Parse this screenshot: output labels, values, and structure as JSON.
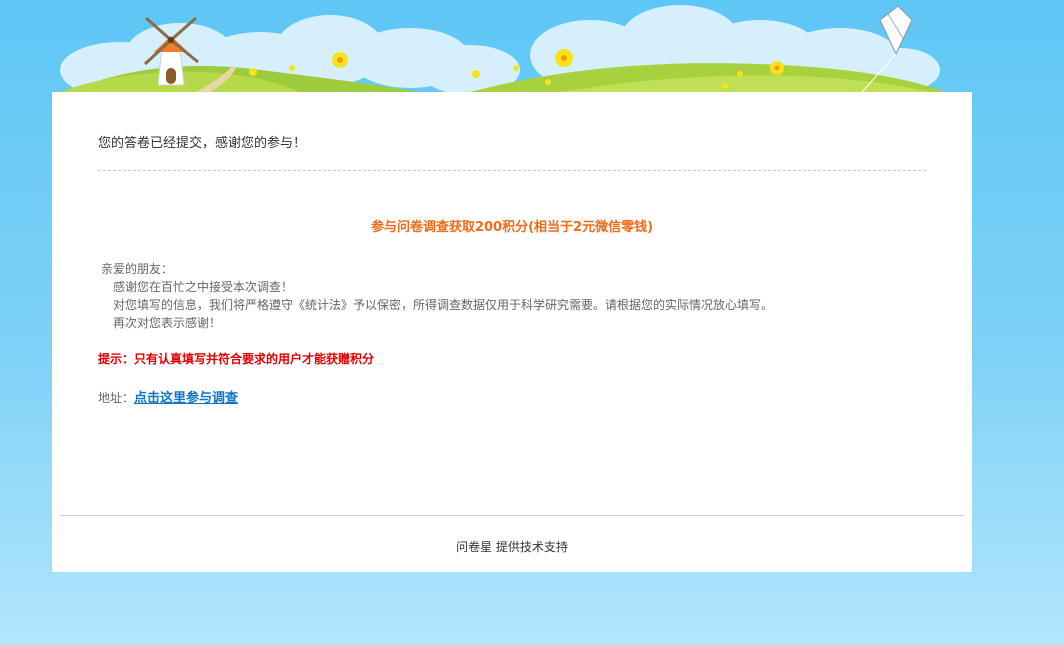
{
  "header": {
    "icons": [
      "windmill-icon",
      "kite-icon",
      "flower-icon",
      "cloud-icon"
    ]
  },
  "main": {
    "submitted_message": "您的答卷已经提交，感谢您的参与！",
    "promo_title": "参与问卷调查获取200积分(相当于2元微信零钱)",
    "letter": {
      "greeting": "亲爱的朋友：",
      "line1": "感谢您在百忙之中接受本次调查！",
      "line2": "对您填写的信息，我们将严格遵守《统计法》予以保密，所得调查数据仅用于科学研究需要。请根据您的实际情况放心填写。",
      "line3": "再次对您表示感谢！"
    },
    "tip": "提示：只有认真填写并符合要求的用户才能获赠积分",
    "address_label": "地址：",
    "address_link": "点击这里参与调查"
  },
  "footer": {
    "text": "问卷星 提供技术支持"
  },
  "colors": {
    "promo": "#f06b1a",
    "tip": "#e60000",
    "link": "#0d74c7",
    "sky": "#5ec6f5"
  }
}
